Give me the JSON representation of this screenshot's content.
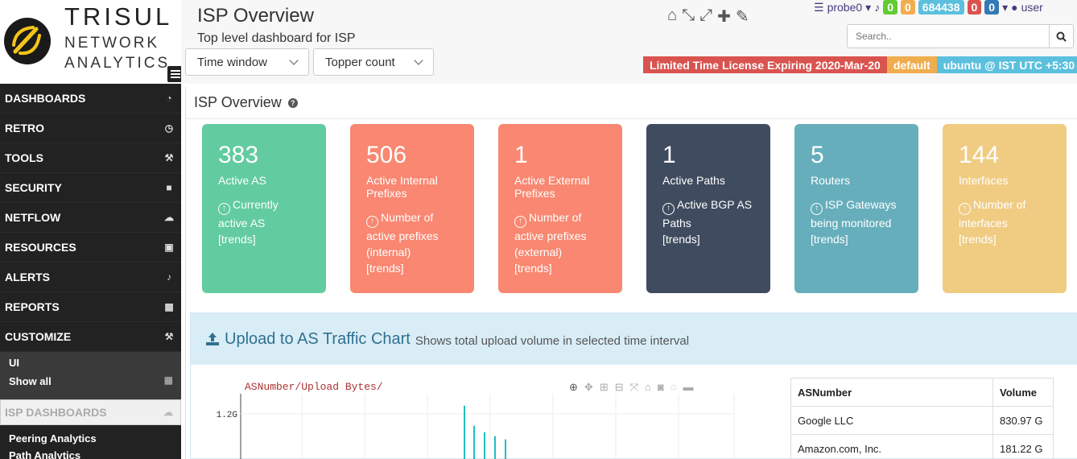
{
  "brand": {
    "line1": "TRISUL",
    "line2": "NETWORK",
    "line3": "ANALYTICS"
  },
  "sidebar": {
    "items": [
      {
        "label": "DASHBOARDS",
        "icon": "dashboard-icon"
      },
      {
        "label": "RETRO",
        "icon": "clock-icon"
      },
      {
        "label": "TOOLS",
        "icon": "wrench-icon"
      },
      {
        "label": "SECURITY",
        "icon": "lock-icon"
      },
      {
        "label": "NETFLOW",
        "icon": "cloud-icon"
      },
      {
        "label": "RESOURCES",
        "icon": "image-icon"
      },
      {
        "label": "ALERTS",
        "icon": "bell-icon"
      },
      {
        "label": "REPORTS",
        "icon": "calendar-icon"
      },
      {
        "label": "CUSTOMIZE",
        "icon": "gavel-icon"
      }
    ],
    "sub": {
      "ui": "UI",
      "show_all": "Show all"
    },
    "isp_dashboards": "ISP DASHBOARDS",
    "peering": "Peering Analytics",
    "peering2": "Path Analytics"
  },
  "header": {
    "title": "ISP Overview",
    "subtitle": "Top level dashboard for ISP",
    "time_window": "Time window",
    "topper_count": "Topper count",
    "probe": "probe0",
    "counts": [
      "0",
      "0",
      "684438",
      "0",
      "0"
    ],
    "user": "user",
    "search_placeholder": "Search..",
    "license": "Limited Time License Expiring 2020-Mar-20",
    "context": "default",
    "host": "ubuntu @ IST UTC +5:30"
  },
  "section": {
    "title": "ISP Overview"
  },
  "tiles": [
    {
      "value": "383",
      "label": "Active AS",
      "desc": "Currently active AS",
      "trends": "[trends]",
      "color": "#62cb9f"
    },
    {
      "value": "506",
      "label": "Active Internal Prefixes",
      "desc": "Number of active prefixes (internal)",
      "trends": "[trends]",
      "color": "#f98771"
    },
    {
      "value": "1",
      "label": "Active External Prefixes",
      "desc": "Number of active prefixes (external)",
      "trends": "[trends]",
      "color": "#f98771"
    },
    {
      "value": "1",
      "label": "Active Paths",
      "desc": "Active BGP AS Paths",
      "trends": "[trends]",
      "color": "#3f4b5e"
    },
    {
      "value": "5",
      "label": "Routers",
      "desc": "ISP Gateways being monitored",
      "trends": "[trends]",
      "color": "#66aebc"
    },
    {
      "value": "144",
      "label": "Interfaces",
      "desc": "Number of interfaces",
      "trends": "[trends]",
      "color": "#f0cc82"
    }
  ],
  "chart_panel": {
    "title": "Upload to AS Traffic Chart",
    "subtitle": "Shows total upload volume in selected time interval"
  },
  "chart_data": {
    "type": "bar",
    "title": "ASNumber/Upload Bytes/",
    "ytick_labels": [
      "1.2G"
    ],
    "values": [
      1.3,
      1.05,
      0.97,
      0.92,
      0.88
    ],
    "ylim": [
      0,
      1.45
    ]
  },
  "as_table": {
    "headers": [
      "ASNumber",
      "Volume"
    ],
    "rows": [
      [
        "Google LLC",
        "830.97 G"
      ],
      [
        "Amazon.com, Inc.",
        "181.22 G"
      ]
    ]
  }
}
